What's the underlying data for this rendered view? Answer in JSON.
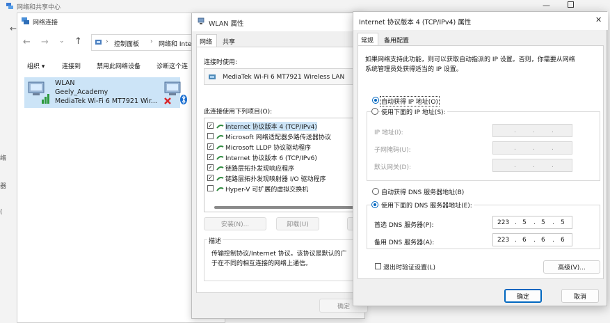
{
  "bg_window": {
    "title": "网络和共享中心",
    "back_label": "←"
  },
  "netconn_window": {
    "title": "网络连接",
    "path": [
      "控制面板",
      "网络和 Intern"
    ],
    "commands": [
      "组织 ▾",
      "连接到",
      "禁用此网络设备",
      "诊断这个连"
    ],
    "adapter": {
      "name": "WLAN",
      "network": "Geely_Academy",
      "device": "MediaTek Wi-Fi 6 MT7921 Wir..."
    }
  },
  "wlan_props": {
    "title": "WLAN 属性",
    "tabs": [
      "网络",
      "共享"
    ],
    "connect_using_label": "连接时使用:",
    "adapter_name": "MediaTek Wi-Fi 6 MT7921 Wireless LAN",
    "items_label": "此连接使用下列项目(O):",
    "items": [
      {
        "label": "Internet 协议版本 4 (TCP/IPv4)",
        "checked": true
      },
      {
        "label": "Microsoft 网络适配器多路传送器协议",
        "checked": false
      },
      {
        "label": "Microsoft LLDP 协议驱动程序",
        "checked": true
      },
      {
        "label": "Internet 协议版本 6 (TCP/IPv6)",
        "checked": true
      },
      {
        "label": "链路层拓扑发现响应程序",
        "checked": true
      },
      {
        "label": "链路层拓扑发现映射器 I/O 驱动程序",
        "checked": true
      },
      {
        "label": "Hyper-V 可扩展的虚拟交换机",
        "checked": false
      }
    ],
    "install_label": "安装(N)...",
    "uninstall_label": "卸载(U)",
    "description_title": "描述",
    "description_line1": "传输控制协议/Internet 协议。该协议是默认的广",
    "description_line2": "于在不同的相互连接的网络上通信。",
    "ok_label": "确定"
  },
  "ipv4_props": {
    "title": "Internet 协议版本 4 (TCP/IPv4) 属性",
    "close_label": "✕",
    "tabs": [
      "常规",
      "备用配置"
    ],
    "intro_line1": "如果网络支持此功能，则可以获取自动指派的 IP 设置。否则，你需要从网络",
    "intro_line2": "系统管理员处获得适当的 IP 设置。",
    "auto_ip_label": "自动获得 IP 地址(O)",
    "manual_ip_label": "使用下面的 IP 地址(S):",
    "ip_label": "IP 地址(I):",
    "mask_label": "子网掩码(U):",
    "gateway_label": "默认网关(D):",
    "auto_dns_label": "自动获得 DNS 服务器地址(B)",
    "manual_dns_label": "使用下面的 DNS 服务器地址(E):",
    "preferred_dns_label": "首选 DNS 服务器(P):",
    "preferred_dns": [
      "223",
      "5",
      "5",
      "5"
    ],
    "alternate_dns_label": "备用 DNS 服务器(A):",
    "alternate_dns": [
      "223",
      "6",
      "6",
      "6"
    ],
    "validate_label": "退出时验证设置(L)",
    "advanced_label": "高级(V)...",
    "ok_label": "确定",
    "cancel_label": "取消",
    "ip_mode": "auto",
    "dns_mode": "manual"
  },
  "colors": {
    "accent": "#0067c0",
    "selection": "#cce4f7"
  }
}
